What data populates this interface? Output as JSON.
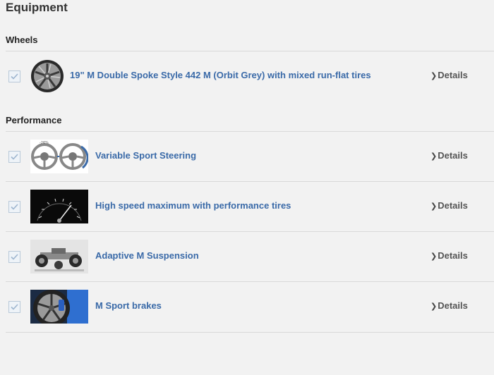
{
  "page": {
    "title": "Equipment"
  },
  "sections": [
    {
      "title": "Wheels",
      "items": [
        {
          "label": "19\" M Double Spoke Style 442 M (Orbit Grey) with mixed run-flat tires",
          "details": "Details",
          "icon": "wheel-icon",
          "checked": true
        }
      ]
    },
    {
      "title": "Performance",
      "items": [
        {
          "label": "Variable Sport Steering",
          "details": "Details",
          "icon": "steering-wheel-icon",
          "checked": true
        },
        {
          "label": "High speed maximum with performance tires",
          "details": "Details",
          "icon": "speedometer-icon",
          "checked": true
        },
        {
          "label": "Adaptive M Suspension",
          "details": "Details",
          "icon": "suspension-icon",
          "checked": true
        },
        {
          "label": "M Sport brakes",
          "details": "Details",
          "icon": "brake-icon",
          "checked": true
        }
      ]
    }
  ],
  "colors": {
    "link": "#3a6aa8",
    "divider": "#d9d9d9",
    "background": "#f2f2f2"
  }
}
